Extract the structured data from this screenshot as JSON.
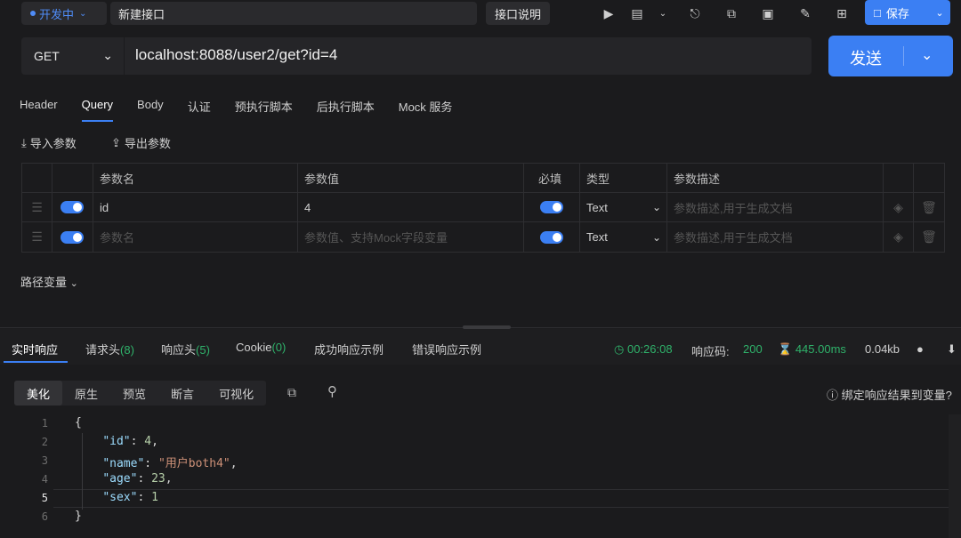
{
  "topbar": {
    "env_label": "开发中",
    "tab_title": "新建接口",
    "doc_button": "接口说明",
    "save_label": "保存"
  },
  "request": {
    "method": "GET",
    "url": "localhost:8088/user2/get?id=4",
    "send_label": "发送"
  },
  "req_tabs": [
    {
      "label": "Header"
    },
    {
      "label": "Query"
    },
    {
      "label": "Body"
    },
    {
      "label": "认证"
    },
    {
      "label": "预执行脚本"
    },
    {
      "label": "后执行脚本"
    },
    {
      "label": "Mock 服务"
    }
  ],
  "import_label": "导入参数",
  "export_label": "导出参数",
  "params_table": {
    "headers": {
      "name": "参数名",
      "value": "参数值",
      "required": "必填",
      "type": "类型",
      "desc": "参数描述"
    },
    "rows": [
      {
        "name": "id",
        "value": "4",
        "type": "Text",
        "desc_placeholder": "参数描述,用于生成文档"
      },
      {
        "name_placeholder": "参数名",
        "value_placeholder": "参数值、支持Mock字段变量",
        "type": "Text",
        "desc_placeholder": "参数描述,用于生成文档"
      }
    ]
  },
  "path_vars_label": "路径变量",
  "response": {
    "tabs": {
      "realtime": "实时响应",
      "req_headers": "请求头",
      "req_headers_count": "(8)",
      "resp_headers": "响应头",
      "resp_headers_count": "(5)",
      "cookie": "Cookie",
      "cookie_count": "(0)",
      "success_example": "成功响应示例",
      "error_example": "错误响应示例"
    },
    "time": "00:26:08",
    "status_label": "响应码:",
    "status_code": "200",
    "duration": "445.00ms",
    "size": "0.04kb",
    "view_tabs": [
      "美化",
      "原生",
      "预览",
      "断言",
      "可视化"
    ],
    "bind_label": "绑定响应结果到变量?",
    "line_numbers": [
      "1",
      "2",
      "3",
      "4",
      "5",
      "6"
    ],
    "body": {
      "open": "{",
      "id_key": "\"id\"",
      "id_val": "4",
      "name_key": "\"name\"",
      "name_val": "\"用户both4\"",
      "age_key": "\"age\"",
      "age_val": "23",
      "sex_key": "\"sex\"",
      "sex_val": "1",
      "close": "}"
    }
  },
  "colors": {
    "accent": "#3b7ff3",
    "success": "#2fb26a",
    "background": "#1b1b1d"
  }
}
